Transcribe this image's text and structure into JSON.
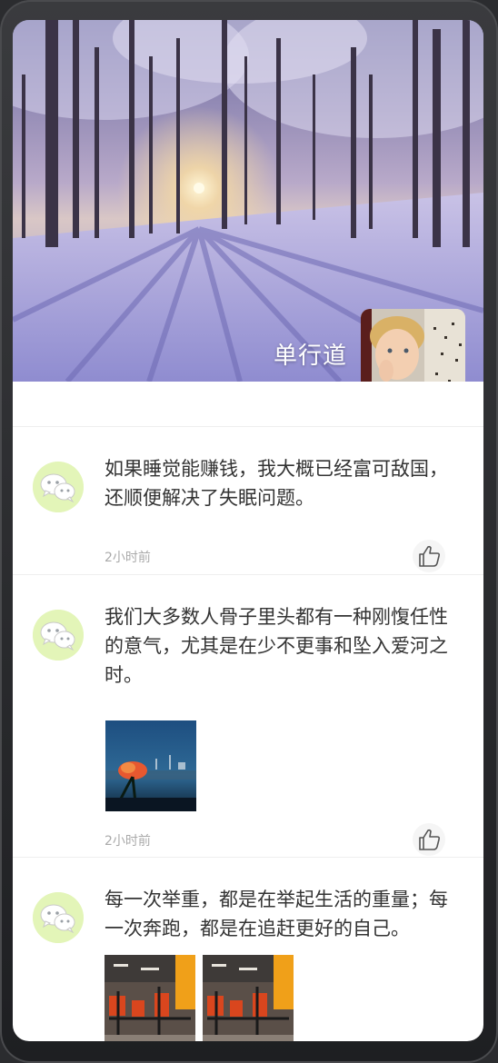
{
  "profile": {
    "name": "单行道"
  },
  "posts": [
    {
      "text": "如果睡觉能赚钱，我大概已经富可敌国，还顺便解决了失眠问题。",
      "time": "2小时前",
      "avatar_icon": "wechat-icon",
      "like_icon": "thumbs-up-icon"
    },
    {
      "text": "我们大多数人骨子里头都有一种刚愎任性的意气，尤其是在少不更事和坠入爱河之时。",
      "time": "2小时前",
      "avatar_icon": "wechat-icon",
      "like_icon": "thumbs-up-icon",
      "images": [
        "night-flower-photo"
      ]
    },
    {
      "text": "每一次举重，都是在举起生活的重量；每一次奔跑，都是在追赶更好的自己。",
      "avatar_icon": "wechat-icon",
      "images": [
        "gym-photo-1",
        "gym-photo-2"
      ]
    }
  ],
  "colors": {
    "avatar_bg": "#e3f5b8",
    "text": "#333333",
    "time": "#aaaaaa"
  }
}
